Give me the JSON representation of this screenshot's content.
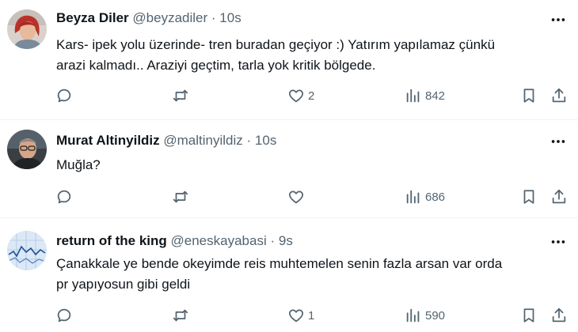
{
  "tweets": [
    {
      "name": "Beyza Diler",
      "handle": "@beyzadiler",
      "dot": "·",
      "time": "10s",
      "text_lines": [
        "Kars- ipek yolu üzerinde- tren buradan geçiyor :) Yatırım yapılamaz çünkü",
        "arazi kalmadı.. Araziyi geçtim, tarla yok kritik bölgede."
      ],
      "likes": "2",
      "views": "842",
      "avatar": "avatar-red-hair-woman"
    },
    {
      "name": "Murat Altinyildiz",
      "handle": "@maltinyildiz",
      "dot": "·",
      "time": "10s",
      "text_lines": [
        "Muğla?"
      ],
      "likes": "",
      "views": "686",
      "avatar": "avatar-man-glasses"
    },
    {
      "name": "return of the king",
      "handle": "@eneskayabasi",
      "dot": "·",
      "time": "9s",
      "text_lines": [
        "Çanakkale ye bende okeyimde reis muhtemelen senin fazla arsan var orda",
        "pr yapıyosun gibi geldi"
      ],
      "likes": "1",
      "views": "590",
      "avatar": "avatar-blue-chart"
    }
  ],
  "icons": {
    "reply": "reply-icon",
    "retweet": "retweet-icon",
    "like": "heart-icon",
    "views": "views-icon",
    "bookmark": "bookmark-icon",
    "share": "share-icon",
    "more": "more-icon"
  },
  "colors": {
    "text": "#0f1419",
    "secondary": "#536471",
    "divider": "#eff3f4"
  }
}
